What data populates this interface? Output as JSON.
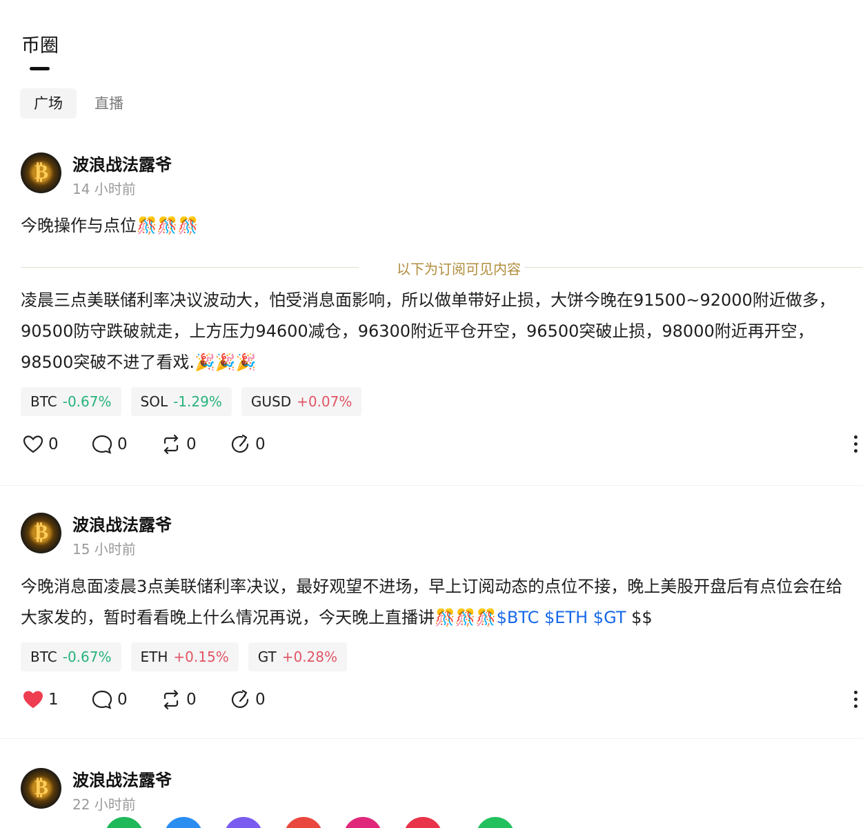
{
  "header": {
    "title": "币圈"
  },
  "subtabs": [
    {
      "label": "广场",
      "active": true
    },
    {
      "label": "直播",
      "active": false
    }
  ],
  "posts": [
    {
      "author": "波浪战法露爷",
      "time": "14 小时前",
      "title": "今晚操作与点位🎊🎊🎊",
      "divider_label": "以下为订阅可见内容",
      "body": "凌晨三点美联储利率决议波动大，怕受消息面影响，所以做单带好止损，大饼今晚在91500~92000附近做多，90500防守跌破就走，上方压力94600减仓，96300附近平仓开空，96500突破止损，98000附近再开空，98500突破不进了看戏.🎉🎉🎉",
      "tickers": [
        {
          "symbol": "BTC",
          "change": "-0.67%",
          "direction": "down"
        },
        {
          "symbol": "SOL",
          "change": "-1.29%",
          "direction": "down"
        },
        {
          "symbol": "GUSD",
          "change": "+0.07%",
          "direction": "up"
        }
      ],
      "likes": "0",
      "comments": "0",
      "reposts": "0",
      "shares": "0",
      "liked": false
    },
    {
      "author": "波浪战法露爷",
      "time": "15 小时前",
      "body": "今晚消息面凌晨3点美联储利率决议，最好观望不进场，早上订阅动态的点位不接，晚上美股开盘后有点位会在给大家发的，暂时看看晚上什么情况再说，今天晚上直播讲🎊🎊🎊",
      "cashtags": "$BTC $ETH $GT",
      "trailing": " $$",
      "tickers": [
        {
          "symbol": "BTC",
          "change": "-0.67%",
          "direction": "down"
        },
        {
          "symbol": "ETH",
          "change": "+0.15%",
          "direction": "up"
        },
        {
          "symbol": "GT",
          "change": "+0.28%",
          "direction": "up"
        }
      ],
      "likes": "1",
      "comments": "0",
      "reposts": "0",
      "shares": "0",
      "liked": true
    },
    {
      "author": "波浪战法露爷",
      "time": "22 小时前"
    }
  ],
  "colors": {
    "up": "#e05565",
    "down": "#26b27a",
    "cashtag": "#1768e8",
    "divider": "#b08d3c",
    "liked": "#ee3d50"
  }
}
